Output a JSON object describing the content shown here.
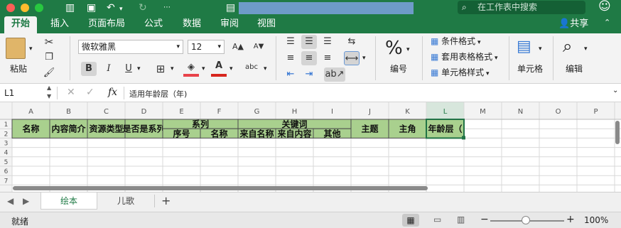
{
  "title_bar": {
    "search_placeholder": "在工作表中搜索",
    "smiley": "☺"
  },
  "tabs": [
    "开始",
    "插入",
    "页面布局",
    "公式",
    "数据",
    "审阅",
    "视图"
  ],
  "share_label": "共享",
  "ribbon": {
    "paste_label": "粘贴",
    "font_name": "微软雅黑",
    "font_size": "12",
    "bold": "B",
    "italic": "I",
    "underline": "U",
    "grow": "A▲",
    "shrink": "A▼",
    "abc": "abc",
    "number_label": "编号",
    "conditional_format": "条件格式",
    "table_format": "套用表格格式",
    "cell_style": "单元格样式",
    "cells_label": "单元格",
    "edit_label": "编辑"
  },
  "formula_bar": {
    "name_box": "L1",
    "fx": "fx",
    "formula": "适用年龄层（年)"
  },
  "columns": [
    "A",
    "B",
    "C",
    "D",
    "E",
    "F",
    "G",
    "H",
    "I",
    "J",
    "K",
    "L",
    "M",
    "N",
    "O",
    "P"
  ],
  "rows": [
    "1",
    "2",
    "3",
    "4",
    "5",
    "6",
    "7"
  ],
  "headers": {
    "A": "名称",
    "B": "内容简介",
    "C": "资源类型",
    "D": "是否是系列",
    "EF": "系列",
    "E2": "序号",
    "F2": "名称",
    "GI": "关键词",
    "G2": "来自名称",
    "H2": "来自内容",
    "I2": "其他",
    "J": "主题",
    "K": "主角",
    "L": "年龄层（"
  },
  "sheets": [
    "绘本",
    "儿歌"
  ],
  "add_sheet": "+",
  "status": {
    "ready": "就绪",
    "zoom": "100%",
    "minus": "−",
    "plus": "+"
  },
  "colors": {
    "excel_green": "#1f7a45",
    "header_fill": "#a9d08e",
    "selection": "#217346"
  }
}
